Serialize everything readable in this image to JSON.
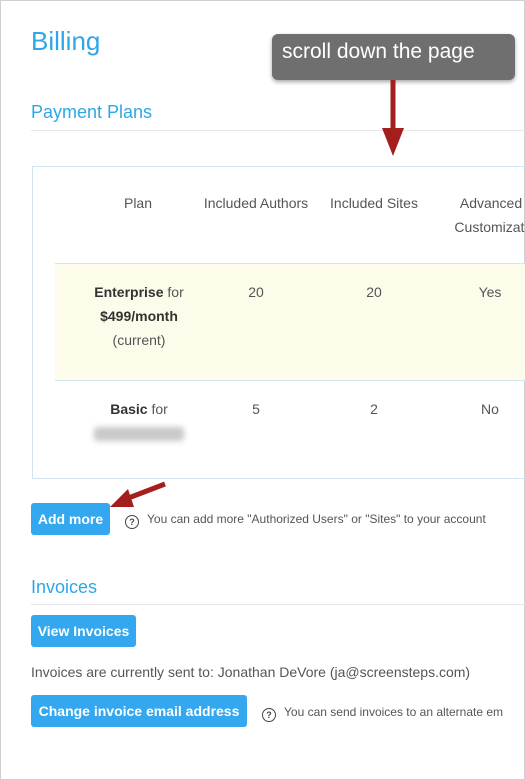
{
  "page": {
    "title": "Billing"
  },
  "annotation": {
    "callout_text": "scroll down the page"
  },
  "payment_plans": {
    "section_title": "Payment Plans",
    "columns": [
      "Plan",
      "Included Authors",
      "Included Sites",
      "Advanced Customizati"
    ],
    "rows": [
      {
        "plan_name": "Enterprise",
        "plan_for": "for",
        "price": "$499/month",
        "status": "(current)",
        "authors": "20",
        "sites": "20",
        "advanced": "Yes"
      },
      {
        "plan_name": "Basic",
        "plan_for": "for",
        "authors": "5",
        "sites": "2",
        "advanced": "No"
      }
    ],
    "add_more_label": "Add more",
    "add_more_help": "You can add more \"Authorized Users\" or \"Sites\" to your account"
  },
  "invoices": {
    "section_title": "Invoices",
    "view_label": "View Invoices",
    "sent_to_text": "Invoices are currently sent to: Jonathan DeVore (ja@screensteps.com)",
    "change_email_label": "Change invoice email address",
    "change_email_help": "You can send invoices to an alternate em"
  },
  "icons": {
    "help": "question-circle-icon",
    "arrow": "red-arrow-icon"
  },
  "colors": {
    "accent": "#2da7e8",
    "button": "#33a7ef",
    "current_row": "#fdfbe9",
    "arrow": "#a51e1e",
    "callout": "#6f6f6f"
  }
}
